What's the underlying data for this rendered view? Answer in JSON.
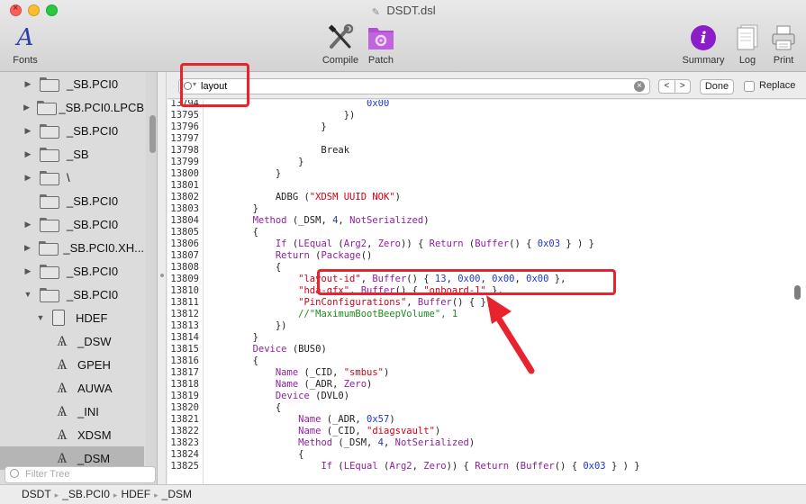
{
  "window": {
    "title": "DSDT.dsl"
  },
  "toolbar": {
    "fonts_label": "Fonts",
    "compile_label": "Compile",
    "patch_label": "Patch",
    "summary_label": "Summary",
    "log_label": "Log",
    "print_label": "Print"
  },
  "sidebar": {
    "items": [
      {
        "label": "_SB.PCI0",
        "kind": "folder",
        "disclosure": "▶"
      },
      {
        "label": "_SB.PCI0.LPCB",
        "kind": "folder",
        "disclosure": "▶"
      },
      {
        "label": "_SB.PCI0",
        "kind": "folder",
        "disclosure": "▶"
      },
      {
        "label": "_SB",
        "kind": "folder",
        "disclosure": "▶"
      },
      {
        "label": "\\",
        "kind": "folder",
        "disclosure": "▶"
      },
      {
        "label": "_SB.PCI0",
        "kind": "folder",
        "disclosure": ""
      },
      {
        "label": "_SB.PCI0",
        "kind": "folder",
        "disclosure": "▶"
      },
      {
        "label": "_SB.PCI0.XH...",
        "kind": "folder",
        "disclosure": "▶"
      },
      {
        "label": "_SB.PCI0",
        "kind": "folder",
        "disclosure": "▶"
      },
      {
        "label": "_SB.PCI0",
        "kind": "folder",
        "disclosure": "▼"
      },
      {
        "label": "HDEF",
        "kind": "device",
        "disclosure": "▼"
      },
      {
        "label": "_DSW",
        "kind": "method",
        "disclosure": ""
      },
      {
        "label": "GPEH",
        "kind": "method",
        "disclosure": ""
      },
      {
        "label": "AUWA",
        "kind": "method",
        "disclosure": ""
      },
      {
        "label": "_INI",
        "kind": "method",
        "disclosure": ""
      },
      {
        "label": "XDSM",
        "kind": "method",
        "disclosure": ""
      },
      {
        "label": "_DSM",
        "kind": "method",
        "disclosure": "",
        "selected": true
      }
    ],
    "filter_placeholder": "Filter Tree"
  },
  "findbar": {
    "search_value": "layout",
    "prev_label": "<",
    "next_label": ">",
    "done_label": "Done",
    "replace_label": "Replace"
  },
  "editor": {
    "lines": [
      {
        "n": "13794",
        "html": "                            <span class='num'>0x00</span>"
      },
      {
        "n": "13795",
        "html": "                        })"
      },
      {
        "n": "13796",
        "html": "                    }"
      },
      {
        "n": "13797",
        "html": ""
      },
      {
        "n": "13798",
        "html": "                    Break"
      },
      {
        "n": "13799",
        "html": "                }"
      },
      {
        "n": "13800",
        "html": "            }"
      },
      {
        "n": "13801",
        "html": ""
      },
      {
        "n": "13802",
        "html": "            ADBG (<span class='str'>\"XDSM UUID NOK\"</span>)"
      },
      {
        "n": "13803",
        "html": "        }"
      },
      {
        "n": "13804",
        "html": "        <span class='kw'>Method</span> (_DSM, <span class='num'>4</span>, <span class='kw'>NotSerialized</span>)"
      },
      {
        "n": "13805",
        "html": "        {"
      },
      {
        "n": "13806",
        "html": "            <span class='kw'>If</span> (<span class='kw'>LEqual</span> (<span class='kw'>Arg2</span>, <span class='kw'>Zero</span>)) { <span class='kw'>Return</span> (<span class='kw'>Buffer</span>() { <span class='num'>0x03</span> } ) }"
      },
      {
        "n": "13807",
        "html": "            <span class='kw'>Return</span> (<span class='kw'>Package</span>()"
      },
      {
        "n": "13808",
        "html": "            {"
      },
      {
        "n": "13809",
        "html": "                <span class='str'>\"layout-id\"</span>, <span class='kw'>Buffer</span>() { <span class='num'>13</span>, <span class='num'>0x00</span>, <span class='num'>0x00</span>, <span class='num'>0x00</span> },"
      },
      {
        "n": "13810",
        "html": "                <span class='str'>\"hda-gfx\"</span>, <span class='kw'>Buffer</span>() { <span class='str'>\"onboard-1\"</span> },"
      },
      {
        "n": "13811",
        "html": "                <span class='str'>\"PinConfigurations\"</span>, <span class='kw'>Buffer</span>() { },"
      },
      {
        "n": "13812",
        "html": "                <span class='cmt'>//\"MaximumBootBeepVolume\", 1</span>"
      },
      {
        "n": "13813",
        "html": "            })"
      },
      {
        "n": "13814",
        "html": "        }"
      },
      {
        "n": "13815",
        "html": "        <span class='kw'>Device</span> (BUS0)"
      },
      {
        "n": "13816",
        "html": "        {"
      },
      {
        "n": "13817",
        "html": "            <span class='kw'>Name</span> (_CID, <span class='str'>\"smbus\"</span>)"
      },
      {
        "n": "13818",
        "html": "            <span class='kw'>Name</span> (_ADR, <span class='kw'>Zero</span>)"
      },
      {
        "n": "13819",
        "html": "            <span class='kw'>Device</span> (DVL0)"
      },
      {
        "n": "13820",
        "html": "            {"
      },
      {
        "n": "13821",
        "html": "                <span class='kw'>Name</span> (_ADR, <span class='num'>0x57</span>)"
      },
      {
        "n": "13822",
        "html": "                <span class='kw'>Name</span> (_CID, <span class='str'>\"diagsvault\"</span>)"
      },
      {
        "n": "13823",
        "html": "                <span class='kw'>Method</span> (_DSM, <span class='num'>4</span>, <span class='kw'>NotSerialized</span>)"
      },
      {
        "n": "13824",
        "html": "                {"
      },
      {
        "n": "13825",
        "html": "                    <span class='kw'>If</span> (<span class='kw'>LEqual</span> (<span class='kw'>Arg2</span>, <span class='kw'>Zero</span>)) { <span class='kw'>Return</span> (<span class='kw'>Buffer</span>() { <span class='num'>0x03</span> } ) }"
      }
    ]
  },
  "pathbar": {
    "items": [
      "DSDT",
      "_SB.PCI0",
      "HDEF",
      "_DSM"
    ]
  },
  "colors": {
    "keyword": "#8f1fa0",
    "string": "#d10016",
    "number": "#1d38d1",
    "comment": "#1e8a1e",
    "annotation": "#e8232d",
    "selection": "#b5b5b5"
  }
}
